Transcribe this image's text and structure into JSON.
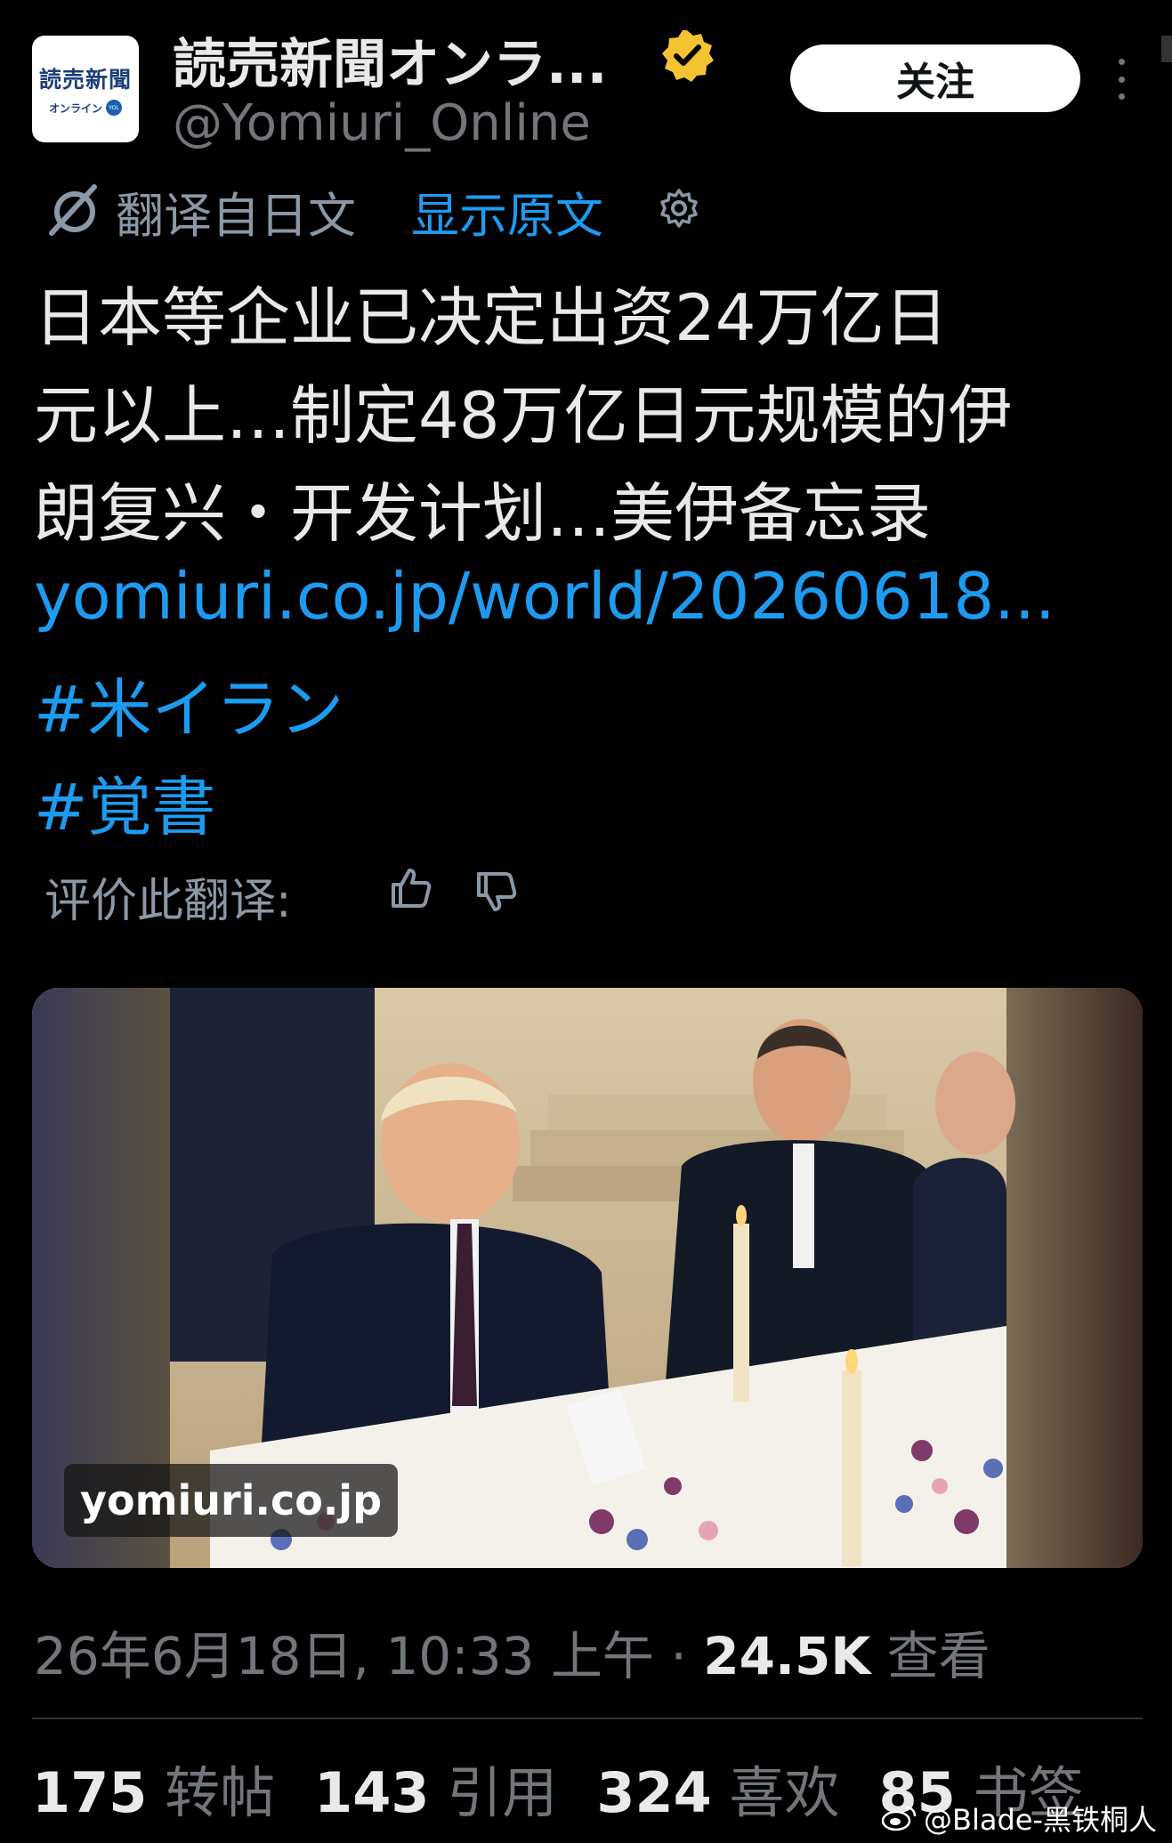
{
  "account": {
    "logo_text": "読売新聞",
    "logo_subtext": "オンライン",
    "logo_badge": "YOL",
    "display_name": "読売新聞オンラ...",
    "handle": "@Yomiuri_Online",
    "verified": true,
    "verified_color": "#f4c430",
    "follow_label": "关注"
  },
  "translation": {
    "label": "翻译自日文",
    "show_original": "显示原文",
    "settings_icon": "gear-icon"
  },
  "post": {
    "lines": [
      "日本等企业已决定出资24万亿日",
      "元以上…制定48万亿日元规模的伊",
      "朗复兴・开发计划…美伊备忘录"
    ],
    "link": "yomiuri.co.jp/world/20260618...",
    "hashtags": [
      "#米イラン",
      "#覚書"
    ]
  },
  "rate": {
    "label": "评价此翻译:"
  },
  "media": {
    "source_label": "yomiuri.co.jp"
  },
  "meta": {
    "timestamp": "26年6月18日, 10:33 上午",
    "separator": "·",
    "views": "24.5K",
    "views_label": "查看"
  },
  "stats": [
    {
      "value": "175",
      "label": "转帖"
    },
    {
      "value": "143",
      "label": "引用"
    },
    {
      "value": "324",
      "label": "喜欢"
    },
    {
      "value": "85",
      "label": "书签"
    }
  ],
  "watermark": "@Blade-黑铁桐人",
  "colors": {
    "background": "#000000",
    "link": "#1d9bf0",
    "text": "#e7e9ea",
    "muted": "#71767b"
  }
}
